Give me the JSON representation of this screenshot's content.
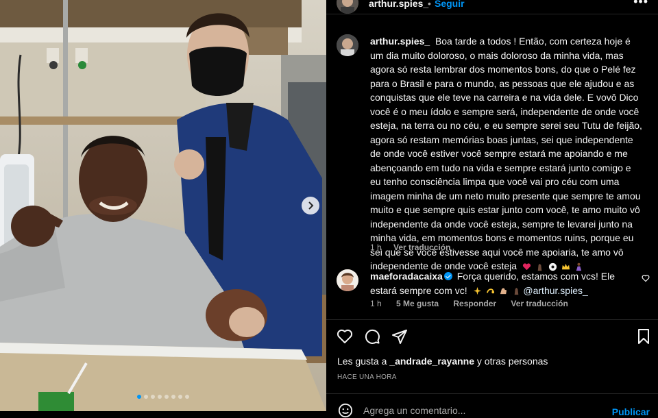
{
  "post": {
    "header": {
      "username": "arthur.spies_",
      "separator": "•",
      "follow_label": "Seguir",
      "more_label": "•••"
    },
    "caption": {
      "username": "arthur.spies_",
      "text": "Boa tarde a todos ! Então, com certeza hoje é um dia muito doloroso, o mais doloroso da minha vida, mas agora só resta lembrar dos momentos bons, do que o Pelé fez para o Brasil e para o mundo, as pessoas que ele ajudou e as conquistas que ele teve na carreira e na vida dele. E vovô Dico você é o meu ídolo e sempre será, independente de onde você esteja, na terra ou no céu, e eu sempre serei seu Tutu de feijão, agora só restam memórias boas juntas, sei que independente de onde você estiver você sempre estará me apoiando e me abençoando em tudo na vida e sempre estará junto comigo e eu tenho consciência limpa que você vai pro céu com uma imagem minha de um neto muito presente que sempre te amou muito e que sempre quis estar junto com você, te amo muito vô independente da onde você esteja, sempre te levarei junto na minha vida, em momentos bons e momentos ruins, porque eu sei que se você estivesse aqui você me apoiaria, te amo vô independente de onde você esteja",
      "emojis": [
        "red-heart",
        "folded-hands",
        "soccer-ball",
        "crown",
        "praying-person"
      ],
      "time": "1 h",
      "translate_label": "Ver traducción"
    },
    "comment": {
      "username": "maeforadacaixa",
      "text": "Força querido, estamos com vcs! Ele estará sempre com vc!",
      "emojis": [
        "sparkles",
        "dizzy",
        "flexed-biceps",
        "folded-hands"
      ],
      "mention": "@arthur.spies_",
      "time": "1 h",
      "likes_label": "5 Me gusta",
      "reply_label": "Responder",
      "translate_label": "Ver traducción"
    },
    "likes": {
      "prefix": "Les gusta a ",
      "user": "_andrade_rayanne",
      "suffix": " y otras personas"
    },
    "timestamp": "HACE UNA HORA",
    "add_comment": {
      "placeholder": "Agrega un comentario...",
      "publish_label": "Publicar"
    },
    "carousel": {
      "total_slides": 8,
      "active_index": 0
    },
    "colors": {
      "accent": "#0095f6",
      "background": "#000000",
      "secondary_text": "#a8a8a8",
      "divider": "#262626"
    }
  }
}
